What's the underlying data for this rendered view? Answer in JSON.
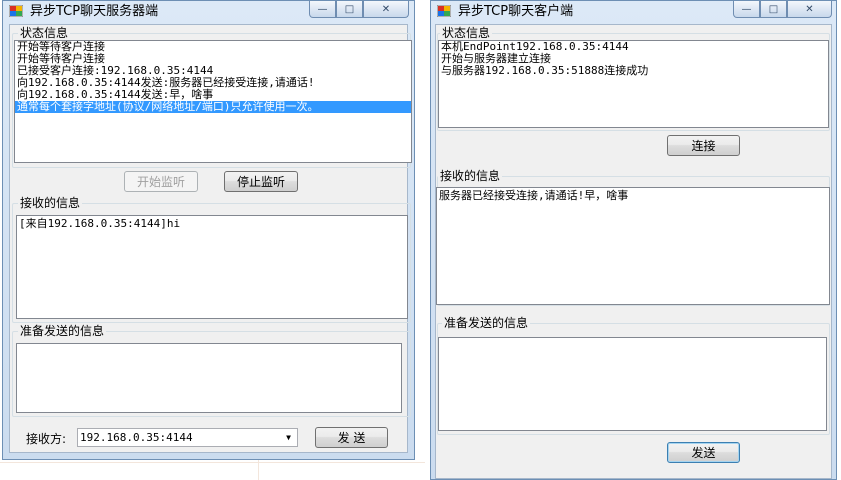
{
  "server": {
    "title": "异步TCP聊天服务器端",
    "status_group_label": "状态信息",
    "status_items": [
      "开始等待客户连接",
      "开始等待客户连接",
      "已接受客户连接:192.168.0.35:4144",
      "向192.168.0.35:4144发送:服务器已经接受连接,请通话!",
      "向192.168.0.35:4144发送:早，啥事",
      "通常每个套接字地址(协议/网络地址/端口)只允许使用一次。"
    ],
    "start_listen_label": "开始监听",
    "stop_listen_label": "停止监听",
    "received_group_label": "接收的信息",
    "received_text": "[来自192.168.0.35:4144]hi",
    "send_group_label": "准备发送的信息",
    "send_text": "",
    "receiver_label": "接收方:",
    "receiver_value": "192.168.0.35:4144",
    "send_button_label": "发 送"
  },
  "client": {
    "title": "异步TCP聊天客户端",
    "status_group_label": "状态信息",
    "status_items": [
      "本机EndPoint192.168.0.35:4144",
      "开始与服务器建立连接",
      "与服务器192.168.0.35:51888连接成功"
    ],
    "connect_label": "连接",
    "received_group_label": "接收的信息",
    "received_text": "服务器已经接受连接,请通话!早，啥事",
    "send_group_label": "准备发送的信息",
    "send_text": "",
    "send_button_label": "发送"
  },
  "window_controls": {
    "minimize": "—",
    "maximize": "□",
    "close": "✕"
  },
  "colors": {
    "selection": "#3399ff",
    "window_frame": "#cbdcef"
  }
}
